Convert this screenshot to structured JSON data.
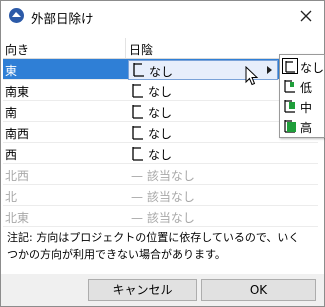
{
  "window": {
    "title": "外部日除け"
  },
  "table": {
    "headers": [
      "向き",
      "日陰"
    ],
    "rows": [
      {
        "dir": "東",
        "value": "なし",
        "state": "selected"
      },
      {
        "dir": "南東",
        "value": "なし",
        "state": "normal"
      },
      {
        "dir": "南",
        "value": "なし",
        "state": "normal"
      },
      {
        "dir": "南西",
        "value": "なし",
        "state": "normal"
      },
      {
        "dir": "西",
        "value": "なし",
        "state": "normal"
      },
      {
        "dir": "北西",
        "value": "— 該当なし",
        "state": "disabled"
      },
      {
        "dir": "北",
        "value": "— 該当なし",
        "state": "disabled"
      },
      {
        "dir": "北東",
        "value": "— 該当なし",
        "state": "disabled"
      }
    ]
  },
  "dropdown": {
    "options": [
      "なし",
      "低",
      "中",
      "高"
    ],
    "highlighted": "なし"
  },
  "note": "注記: 方向はプロジェクトの位置に依存しているので、いくつかの方向が利用できない場合があります。",
  "buttons": {
    "cancel": "キャンセル",
    "ok": "OK"
  },
  "colors": {
    "selection": "#2f7fd6",
    "shade_green": "#1f9e3a",
    "disabled_text": "#a8a8a8"
  },
  "icons": {
    "app": "shading-app-icon",
    "close": "close-icon",
    "shade": "shade-level-icon",
    "cursor": "mouse-pointer-icon"
  }
}
